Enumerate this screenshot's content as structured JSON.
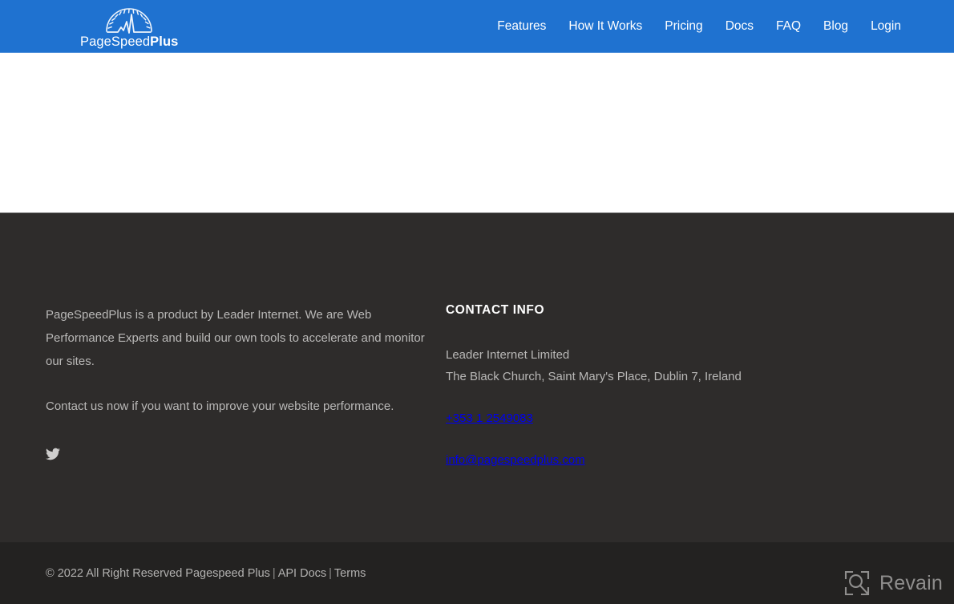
{
  "header": {
    "brand": {
      "logo_icon": "speedometer-gauge-icon",
      "name_light": "PageSpeed",
      "name_bold": "Plus"
    },
    "nav": [
      {
        "label": "Features"
      },
      {
        "label": "How It Works"
      },
      {
        "label": "Pricing"
      },
      {
        "label": "Docs"
      },
      {
        "label": "FAQ"
      },
      {
        "label": "Blog"
      },
      {
        "label": "Login"
      }
    ],
    "background_color": "#1f72d0",
    "text_color": "#ffffff"
  },
  "main": {
    "content": ""
  },
  "footer": {
    "background_color": "#2e2c2b",
    "about": {
      "paragraph_1": "PageSpeedPlus is a product by Leader Internet. We are Web Performance Experts and build our own tools to accelerate and monitor our sites.",
      "paragraph_2": "Contact us now if you want to improve your website performance.",
      "social": [
        {
          "icon": "twitter-icon",
          "label": "Twitter"
        }
      ]
    },
    "contact": {
      "heading": "CONTACT INFO",
      "company": "Leader Internet Limited",
      "address": "The Black Church, Saint Mary's Place, Dublin 7, Ireland",
      "phone": "+353 1 2549083",
      "email": "info@pagespeedplus.com"
    },
    "bottom": {
      "background_color": "#232221",
      "copyright": "© 2022 All Right Reserved Pagespeed Plus",
      "separator": "|",
      "link_api_docs": "API Docs",
      "link_terms": "Terms"
    }
  },
  "watermark": {
    "icon": "revain-logo-icon",
    "label": "Revain",
    "color": "#8f8e8d"
  }
}
